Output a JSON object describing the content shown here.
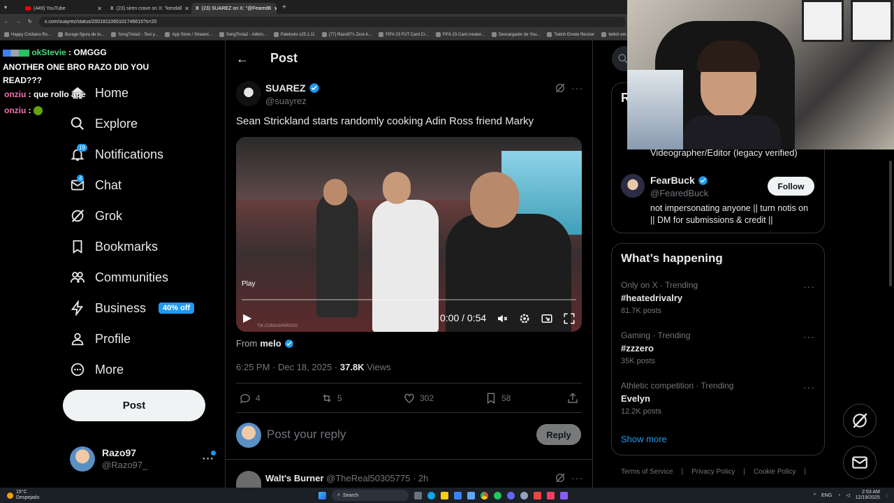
{
  "browser": {
    "tabs": [
      {
        "label": "(449) YouTube"
      },
      {
        "label": "(23) siren crave on X: \"kendall"
      },
      {
        "label": "(23) SUAREZ on X: \"@FearedB"
      }
    ],
    "url": "x.com/suayrez/status/2001811065101746615?s=20",
    "bookmarks": [
      "Happy Cristiano Ro...",
      "Burago figura de to...",
      "SongTrivia2 - Test y...",
      "App Store / Streami...",
      "SongTrivia2 - Adivin...",
      "Paletools v25.1.11",
      "(77) Razo97's Zest-A...",
      "FIFA 23 FUT Card Cr...",
      "FIFA 23 Card creator...",
      "Descargador de You...",
      "Twitch Emote Resizer",
      "twitch em"
    ]
  },
  "chat": [
    {
      "user": "okStevie",
      "sep": ":",
      "msg": "OMGGG"
    },
    {
      "user": "",
      "sep": "",
      "msg": "ANOTHER ONE BRO RAZO DID YOU READ???"
    },
    {
      "user": "onziu",
      "sep": ":",
      "msg": "que rollo ape"
    },
    {
      "user": "onziu",
      "sep": ":",
      "msg": ""
    }
  ],
  "nav": {
    "items": [
      {
        "label": "Home"
      },
      {
        "label": "Explore"
      },
      {
        "label": "Notifications",
        "badge": "19"
      },
      {
        "label": "Chat",
        "badge": "4"
      },
      {
        "label": "Grok"
      },
      {
        "label": "Bookmarks"
      },
      {
        "label": "Communities"
      },
      {
        "label": "Business",
        "promo": "40% off"
      },
      {
        "label": "Profile"
      },
      {
        "label": "More"
      }
    ],
    "post_button": "Post",
    "account": {
      "name": "Razo97",
      "handle": "@Razo97_"
    }
  },
  "header": {
    "title": "Post"
  },
  "tweet": {
    "author": "SUAREZ",
    "handle": "@suayrez",
    "text": "Sean Strickland starts randomly cooking Adin Ross friend Marky",
    "video": {
      "play_label": "Play",
      "time": "0:00 / 0:54",
      "watermark": "TIK.COM/ADINROSS",
      "progress": 0
    },
    "from_label": "From",
    "from_name": "melo",
    "timestamp": "6:25 PM · Dec 18, 2025 ·",
    "views": "37.8K",
    "views_label": "Views",
    "stats": {
      "replies": "4",
      "reposts": "5",
      "likes": "302",
      "bookmarks": "58"
    }
  },
  "reply": {
    "placeholder": "Post your reply",
    "button": "Reply"
  },
  "next_reply": {
    "name": "Walt's Burner",
    "handle": "@TheReal50305775",
    "time": "· 2h"
  },
  "sidebar": {
    "relevant_heading_fragment": "R",
    "prev_bio": "Videographer/Editor (legacy verified)",
    "person": {
      "name": "FearBuck",
      "handle": "@FearedBuck",
      "bio": "not impersonating anyone || turn notis on || DM for submissions & credit ||",
      "follow": "Follow"
    },
    "happening": {
      "title": "What’s happening",
      "trends": [
        {
          "meta": "Only on X · Trending",
          "name": "#heatedrivalry",
          "count": "81.7K posts"
        },
        {
          "meta": "Gaming · Trending",
          "name": "#zzzero",
          "count": "35K posts"
        },
        {
          "meta": "Athletic competition · Trending",
          "name": "Evelyn",
          "count": "12.2K posts"
        }
      ],
      "show_more": "Show more"
    },
    "footer": [
      "Terms of Service",
      "Privacy Policy",
      "Cookie Policy"
    ]
  },
  "taskbar": {
    "weather": "15°C",
    "weather_desc": "Despejado",
    "search": "Search",
    "lang": "ENG",
    "time": "2:53 AM",
    "date": "12/19/2025"
  }
}
